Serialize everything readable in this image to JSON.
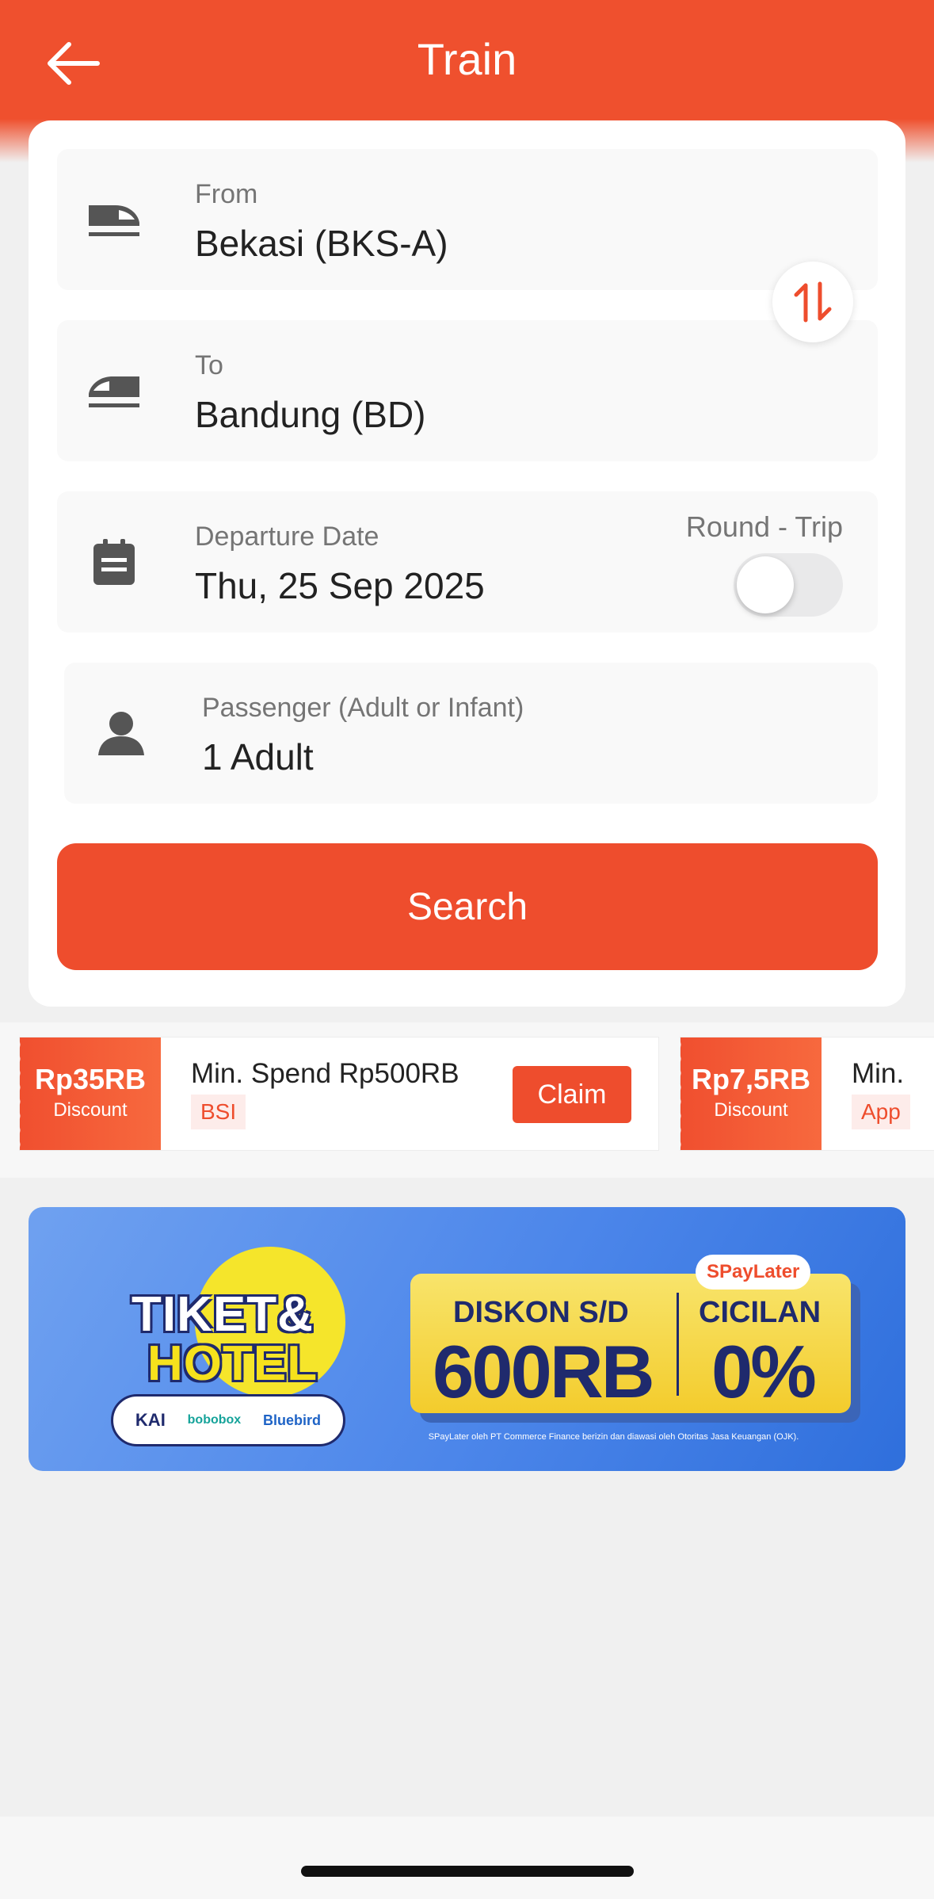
{
  "header": {
    "title": "Train"
  },
  "form": {
    "from": {
      "label": "From",
      "value": "Bekasi (BKS-A)"
    },
    "to": {
      "label": "To",
      "value": "Bandung (BD)"
    },
    "departure": {
      "label": "Departure Date",
      "value": "Thu, 25 Sep 2025"
    },
    "round_trip": {
      "label": "Round - Trip",
      "enabled": false
    },
    "passenger": {
      "label": "Passenger (Adult or Infant)",
      "value": "1 Adult"
    },
    "search_label": "Search"
  },
  "vouchers": [
    {
      "amount": "Rp35RB",
      "type": "Discount",
      "description": "Min. Spend Rp500RB",
      "tag": "BSI",
      "action": "Claim"
    },
    {
      "amount": "Rp7,5RB",
      "type": "Discount",
      "description": "Min.",
      "tag": "App"
    }
  ],
  "banner": {
    "headline_1": "TIKET&",
    "headline_2": "HOTEL",
    "partners": [
      "KAI",
      "bobobox",
      "Bluebird"
    ],
    "promo_left_1": "DISKON S/D",
    "promo_left_2": "600RB",
    "promo_right_1": "CICILAN",
    "promo_right_2": "0%",
    "badge": "SPayLater",
    "disclaimer": "SPayLater oleh PT Commerce Finance berizin dan diawasi oleh Otoritas Jasa Keuangan (OJK)."
  },
  "colors": {
    "primary": "#ee4d2d",
    "header": "#ef502e",
    "background": "#f0f0f0"
  },
  "icons": {
    "back": "arrow-left-icon",
    "from": "train-icon",
    "to": "train-icon",
    "swap": "swap-vertical-icon",
    "date": "calendar-icon",
    "passenger": "person-icon"
  }
}
